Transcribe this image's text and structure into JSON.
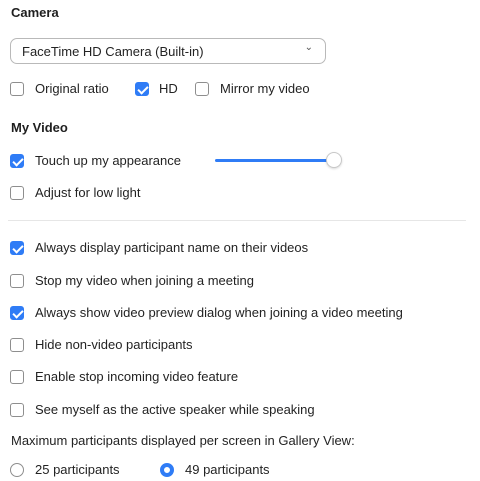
{
  "camera": {
    "title": "Camera",
    "selected_camera": "FaceTime HD Camera (Built-in)",
    "options": [
      {
        "label": "Original ratio",
        "checked": false
      },
      {
        "label": "HD",
        "checked": true
      },
      {
        "label": "Mirror my video",
        "checked": false
      }
    ]
  },
  "my_video": {
    "title": "My Video",
    "touch_up": {
      "label": "Touch up my appearance",
      "checked": true,
      "slider_level": 1.0
    },
    "low_light": {
      "label": "Adjust for low light",
      "checked": false
    }
  },
  "settings": [
    {
      "label": "Always display participant name on their videos",
      "checked": true
    },
    {
      "label": "Stop my video when joining a meeting",
      "checked": false
    },
    {
      "label": "Always show video preview dialog when joining a video meeting",
      "checked": true
    },
    {
      "label": "Hide non-video participants",
      "checked": false
    },
    {
      "label": "Enable stop incoming video feature",
      "checked": false
    },
    {
      "label": "See myself as the active speaker while speaking",
      "checked": false
    }
  ],
  "gallery": {
    "label": "Maximum participants displayed per screen in Gallery View:",
    "options": [
      {
        "label": "25 participants",
        "selected": false
      },
      {
        "label": "49 participants",
        "selected": true
      }
    ]
  },
  "colors": {
    "accent": "#2f7cf6"
  }
}
